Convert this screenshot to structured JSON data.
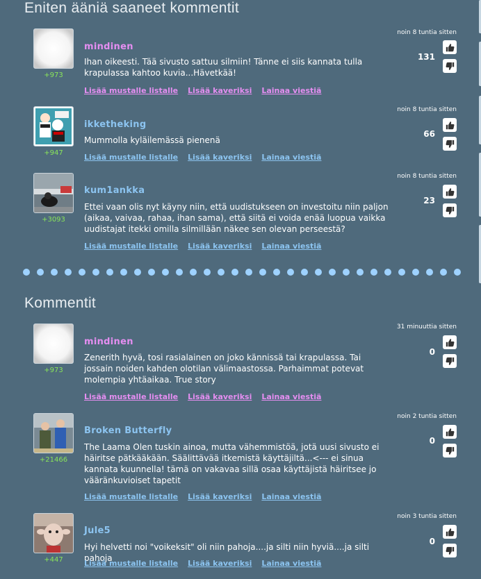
{
  "top_section": {
    "title": "Eniten ääniä saaneet kommentit",
    "comments": [
      {
        "username": "mindinen",
        "score": "+973",
        "text": "Ihan oikeesti. Tää sivusto sattuu silmiin! Tänne ei siis kannata tulla krapulassa kahtoo kuvia...Hävetkää!",
        "time": "noin 8 tuntia sitten",
        "votes": "131",
        "link_blacklist": "Lisää mustalle listalle",
        "link_friend": "Lisää kaveriksi",
        "link_quote": "Lainaa viestiä"
      },
      {
        "username": "ikketheking",
        "score": "+947",
        "text": "Mummolla kyläilemässä pienenä",
        "time": "noin 8 tuntia sitten",
        "votes": "66",
        "link_blacklist": "Lisää mustalle listalle",
        "link_friend": "Lisää kaveriksi",
        "link_quote": "Lainaa viestiä"
      },
      {
        "username": "kum1ankka",
        "score": "+3093",
        "text": "Ettei vaan olis nyt käyny niin, että uudistukseen on investoitu niin paljon (aikaa, vaivaa, rahaa, ihan sama), että siitä ei voida enää luopua vaikka uudistajat itekki omilla silmillään näkee sen olevan perseestä?",
        "time": "noin 8 tuntia sitten",
        "votes": "23",
        "link_blacklist": "Lisää mustalle listalle",
        "link_friend": "Lisää kaveriksi",
        "link_quote": "Lainaa viestiä"
      }
    ]
  },
  "comments_section": {
    "title": "Kommentit",
    "comments": [
      {
        "username": "mindinen",
        "score": "+973",
        "text": "Zenerith hyvä, tosi rasialainen on joko kännissä tai krapulassa. Tai jossain noiden kahden olotilan välimaastossa. Parhaimmat potevat molempia yhtäaikaa. True story",
        "time": "31 minuuttia sitten",
        "votes": "0",
        "link_blacklist": "Lisää mustalle listalle",
        "link_friend": "Lisää kaveriksi",
        "link_quote": "Lainaa viestiä"
      },
      {
        "username": "Broken Butterfly",
        "score": "+21466",
        "text": "The Laama Olen tuskin ainoa, mutta vähemmistöä, jotä uusi sivusto ei häiritse pätkääkään. Säälittävää itkemistä käyttäjiltä...<--- ei sinua kannata kuunnella! tämä on vakavaa sillä osaa käyttäjistä häiritsee jo vääränkuvioiset tapetit",
        "time": "noin 2 tuntia sitten",
        "votes": "0",
        "link_blacklist": "Lisää mustalle listalle",
        "link_friend": "Lisää kaveriksi",
        "link_quote": "Lainaa viestiä"
      },
      {
        "username": "Jule5",
        "score": "+447",
        "text": "Hyi helvetti noi \"voikeksit\" oli niin pahoja....ja silti niin hyviä....ja silti pahoja",
        "time": "noin 3 tuntia sitten",
        "votes": "0",
        "link_blacklist": "Lisää mustalle listalle",
        "link_friend": "Lisää kaveriksi",
        "link_quote": "Lainaa viestiä"
      }
    ]
  },
  "icons": {
    "upvote": "thumbs-up-icon",
    "downvote": "thumbs-down-icon"
  },
  "colors": {
    "background": "#4f6a7c",
    "username_pink": "#e58ef1",
    "username_blue": "#8cc4f0",
    "score_green": "#8ae65a",
    "divider_dot": "#9ed2ff"
  }
}
